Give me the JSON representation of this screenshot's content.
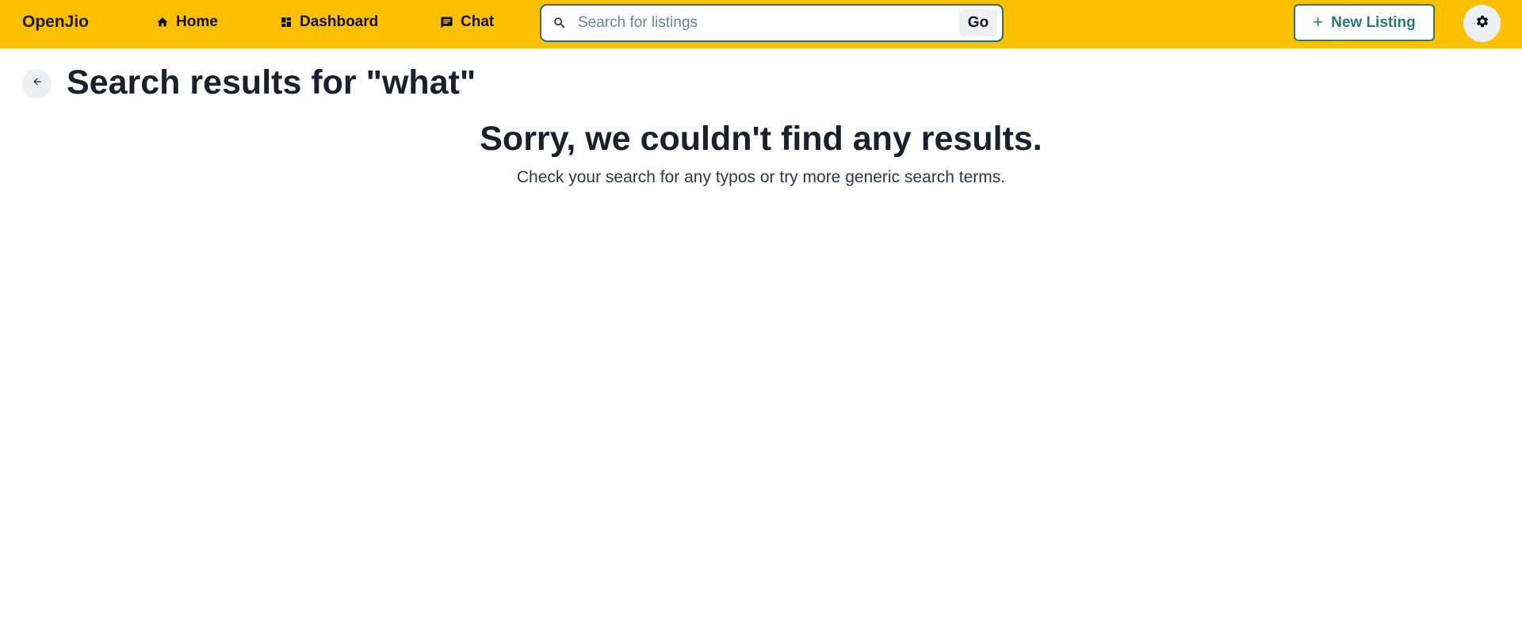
{
  "navbar": {
    "brand": "OpenJio",
    "background_color": "#fcc000",
    "links": [
      {
        "label": "Home",
        "icon": "home-icon"
      },
      {
        "label": "Dashboard",
        "icon": "dashboard-icon"
      },
      {
        "label": "Chat",
        "icon": "chat-icon"
      }
    ],
    "search": {
      "placeholder": "Search for listings",
      "value": "",
      "button_label": "Go",
      "icon": "search-icon"
    },
    "new_listing": {
      "label": "New Listing",
      "icon": "plus-icon",
      "accent_color": "#2a7a72"
    },
    "settings": {
      "icon": "gear-icon"
    }
  },
  "main": {
    "back_icon": "arrow-left-icon",
    "title": "Search results for \"what\"",
    "empty_state": {
      "heading": "Sorry, we couldn't find any results.",
      "subtext": "Check your search for any typos or try more generic search terms."
    }
  }
}
